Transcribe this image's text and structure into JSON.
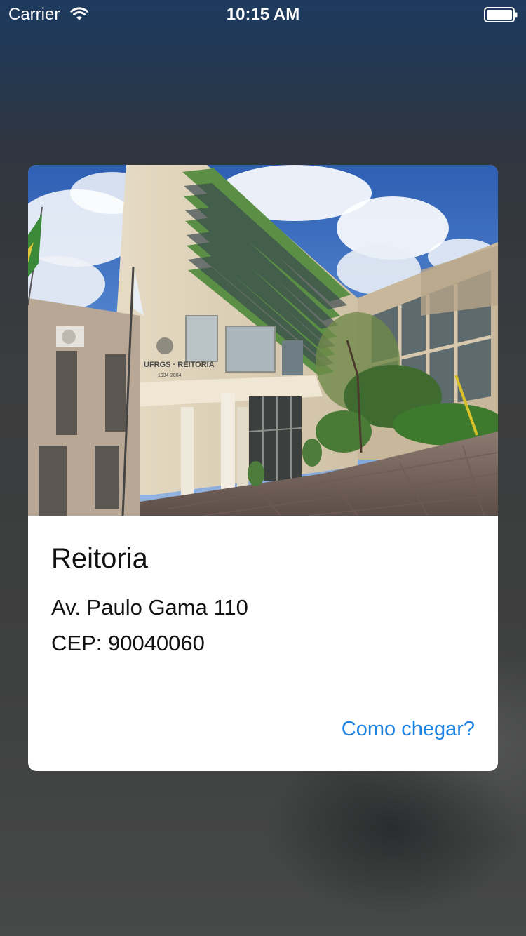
{
  "status_bar": {
    "carrier": "Carrier",
    "time": "10:15 AM",
    "wifi_icon": "wifi-icon",
    "battery_icon": "battery-icon",
    "battery_level": 1.0
  },
  "card": {
    "photo": {
      "icon": "building-photo",
      "sign_text": "UFRGS · REITORIA",
      "sign_years": "1934-2004"
    },
    "title": "Reitoria",
    "address": "Av. Paulo Gama 110",
    "cep": "CEP: 90040060",
    "directions_label": "Como chegar?"
  },
  "colors": {
    "link": "#1a83e6",
    "card_background": "#ffffff",
    "text": "#111111"
  }
}
